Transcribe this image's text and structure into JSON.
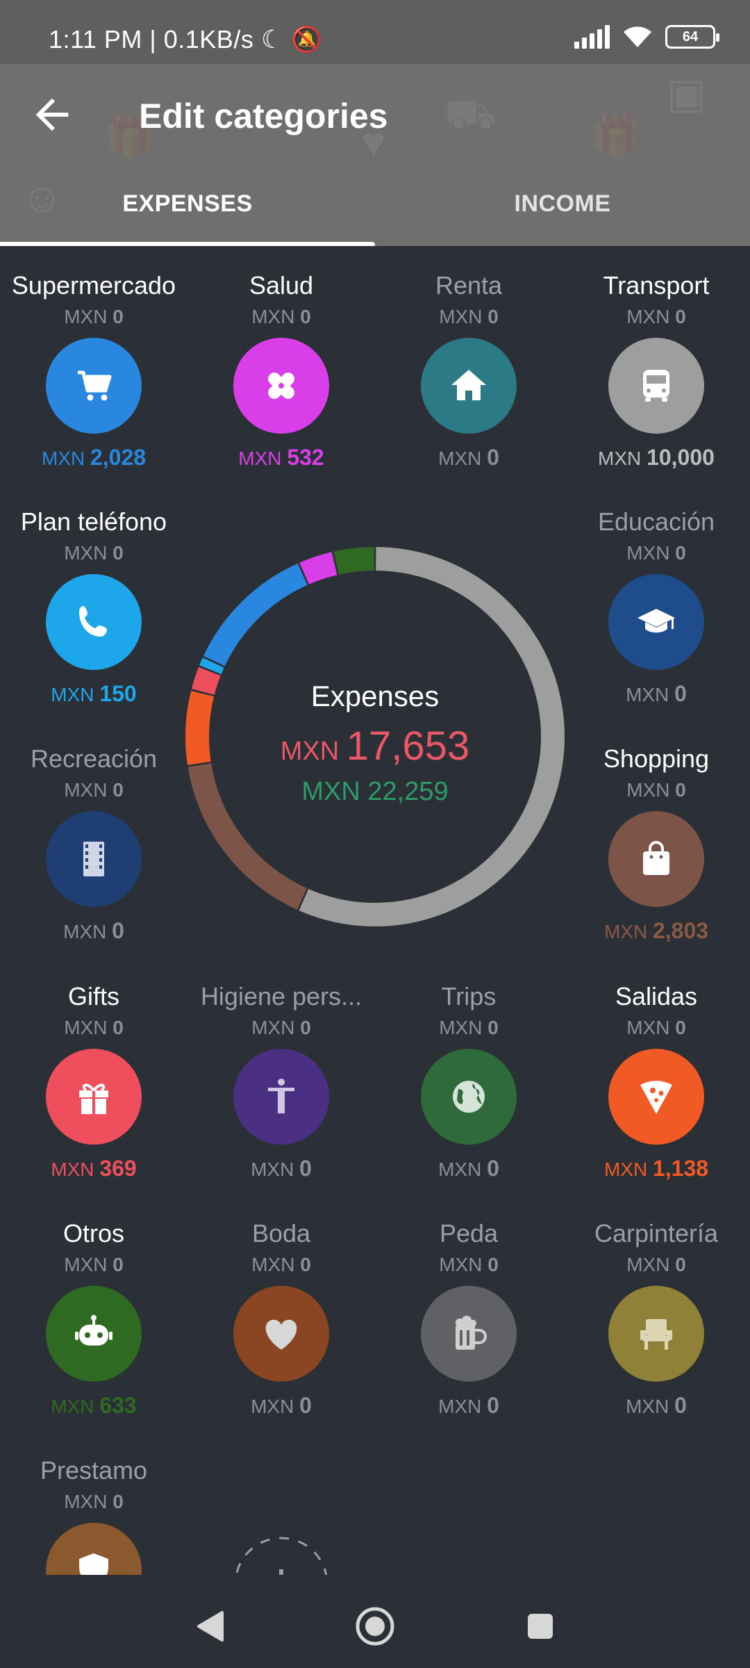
{
  "status": {
    "time_text": "1:11 PM | 0.1KB/s",
    "battery": "64"
  },
  "appbar": {
    "title": "Edit categories"
  },
  "tabs": [
    {
      "label": "EXPENSES",
      "active": true
    },
    {
      "label": "INCOME",
      "active": false
    }
  ],
  "summary": {
    "title": "Expenses",
    "currency": "MXN",
    "spent": "17,653",
    "budget": "22,259",
    "spent_color": "#ea5768",
    "budget_color": "#2e9b6b"
  },
  "categories": [
    {
      "name": "Supermercado",
      "budget": "0",
      "spent": "2,028",
      "color": "#2a87df",
      "icon": "cart-icon",
      "spent_color": "#2a87df",
      "active": true
    },
    {
      "name": "Salud",
      "budget": "0",
      "spent": "532",
      "color": "#d93fe8",
      "icon": "bandage-icon",
      "spent_color": "#d93fe8",
      "active": true
    },
    {
      "name": "Renta",
      "budget": "0",
      "spent": "0",
      "color": "#2c7a86",
      "icon": "home-icon",
      "spent_color": "#8a9099",
      "active": false
    },
    {
      "name": "Transport",
      "budget": "0",
      "spent": "10,000",
      "color": "#9e9e9e",
      "icon": "bus-icon",
      "spent_color": "#b9bdc2",
      "active": true
    },
    {
      "name": "Plan teléfono",
      "budget": "0",
      "spent": "150",
      "color": "#1ea6ea",
      "icon": "phone-icon",
      "spent_color": "#1ea6ea",
      "active": true
    },
    {
      "name": "Educación",
      "budget": "0",
      "spent": "0",
      "color": "#1f4c8a",
      "icon": "graduation-cap-icon",
      "spent_color": "#8a9099",
      "active": false
    },
    {
      "name": "Recreación",
      "budget": "0",
      "spent": "0",
      "color": "#1e3e74",
      "icon": "film-icon",
      "spent_color": "#8a9099",
      "active": false
    },
    {
      "name": "Shopping",
      "budget": "0",
      "spent": "2,803",
      "color": "#7d5548",
      "icon": "shopping-bag-icon",
      "spent_color": "#8a5a47",
      "active": true
    },
    {
      "name": "Gifts",
      "budget": "0",
      "spent": "369",
      "color": "#ef4e5c",
      "icon": "gift-icon",
      "spent_color": "#ef4e5c",
      "active": true
    },
    {
      "name": "Higiene pers...",
      "budget": "0",
      "spent": "0",
      "color": "#4a2f82",
      "icon": "accessibility-icon",
      "spent_color": "#8a9099",
      "active": false
    },
    {
      "name": "Trips",
      "budget": "0",
      "spent": "0",
      "color": "#2e6a3a",
      "icon": "globe-icon",
      "spent_color": "#8a9099",
      "active": false
    },
    {
      "name": "Salidas",
      "budget": "0",
      "spent": "1,138",
      "color": "#f15a25",
      "icon": "pizza-icon",
      "spent_color": "#f15a25",
      "active": true
    },
    {
      "name": "Otros",
      "budget": "0",
      "spent": "633",
      "color": "#2f6a22",
      "icon": "robot-icon",
      "spent_color": "#2f6a22",
      "active": true
    },
    {
      "name": "Boda",
      "budget": "0",
      "spent": "0",
      "color": "#8a4522",
      "icon": "heart-icon",
      "spent_color": "#8a9099",
      "active": false
    },
    {
      "name": "Peda",
      "budget": "0",
      "spent": "0",
      "color": "#5f6164",
      "icon": "beer-icon",
      "spent_color": "#8a9099",
      "active": false
    },
    {
      "name": "Carpintería",
      "budget": "0",
      "spent": "0",
      "color": "#8f8238",
      "icon": "chair-icon",
      "spent_color": "#8a9099",
      "active": false
    },
    {
      "name": "Prestamo",
      "budget": "0",
      "spent": "",
      "color": "#8a5a2e",
      "icon": "shield-icon",
      "spent_color": "#8a9099",
      "active": false
    }
  ],
  "donut_segments": [
    {
      "category": "Transport",
      "value": 10000,
      "color": "#9e9e9e"
    },
    {
      "category": "Shopping",
      "value": 2803,
      "color": "#7d5548"
    },
    {
      "category": "Salidas",
      "value": 1138,
      "color": "#f15a25"
    },
    {
      "category": "Gifts",
      "value": 369,
      "color": "#ef4e5c"
    },
    {
      "category": "Plan teléfono",
      "value": 150,
      "color": "#1ea6ea"
    },
    {
      "category": "Supermercado",
      "value": 2028,
      "color": "#2a87df"
    },
    {
      "category": "Salud",
      "value": 532,
      "color": "#d93fe8"
    },
    {
      "category": "Otros",
      "value": 633,
      "color": "#2f6a22"
    }
  ]
}
